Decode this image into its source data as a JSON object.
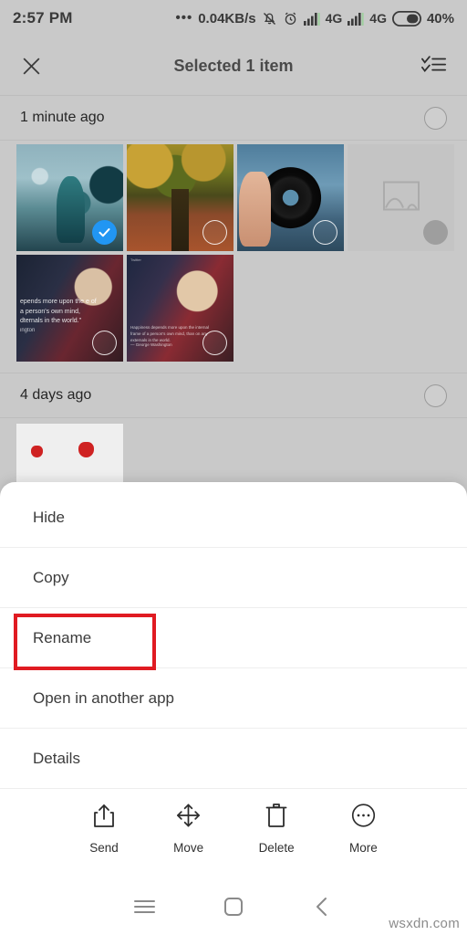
{
  "status_bar": {
    "time": "2:57 PM",
    "dots": "•••",
    "network_rate": "0.04KB/s",
    "alarm_icon": "alarm-icon",
    "silent_icon": "bell-muted-icon",
    "signal_1": "signal-bars-icon",
    "network_1": "4G",
    "signal_2": "signal-bars-icon",
    "network_2": "4G",
    "battery_icon": "battery-icon",
    "battery_level": "40%"
  },
  "app_bar": {
    "close_icon": "close-icon",
    "title": "Selected 1 item",
    "select_all_icon": "checklist-icon"
  },
  "sections": [
    {
      "title": "1 minute ago",
      "select_circle": "unchecked-circle",
      "rows": [
        [
          {
            "name": "statue-photo",
            "art": "art-statue",
            "badge": "checked"
          },
          {
            "name": "autumn-forest-photo",
            "art": "art-autumn",
            "badge": "unchecked"
          },
          {
            "name": "camera-lens-photo",
            "art": "art-lens",
            "badge": "unchecked"
          },
          {
            "name": "placeholder-photo",
            "art": "placeholder",
            "badge": "filled"
          }
        ],
        [
          {
            "name": "washington-quote-photo-1",
            "art": "art-wash1",
            "badge": "unchecked",
            "quote": "epends more upon the\ne of a person's own mind,\ndternals in the world.\"",
            "author": "ington"
          },
          {
            "name": "washington-quote-photo-2",
            "art": "art-wash2",
            "badge": "unchecked",
            "tag": "Twitter",
            "quote": "Happiness depends more upon the internal frame of\na person's own mind, than on any externals in the world.",
            "author": "— George Washington"
          }
        ]
      ]
    },
    {
      "title": "4 days ago",
      "select_circle": "unchecked-circle",
      "rows": []
    }
  ],
  "sheet": {
    "menu_items": [
      {
        "label": "Hide",
        "name": "menu-item-hide",
        "highlighted": false
      },
      {
        "label": "Copy",
        "name": "menu-item-copy",
        "highlighted": false
      },
      {
        "label": "Rename",
        "name": "menu-item-rename",
        "highlighted": true
      },
      {
        "label": "Open in another app",
        "name": "menu-item-open-in-another-app",
        "highlighted": false
      },
      {
        "label": "Details",
        "name": "menu-item-details",
        "highlighted": false
      }
    ],
    "highlight_color": "#e01b22",
    "actions": [
      {
        "label": "Send",
        "icon": "share-icon"
      },
      {
        "label": "Move",
        "icon": "move-arrows-icon"
      },
      {
        "label": "Delete",
        "icon": "trash-icon"
      },
      {
        "label": "More",
        "icon": "more-circle-icon"
      }
    ]
  },
  "nav_bar": {
    "menu_icon": "hamburger-menu-icon",
    "home_icon": "home-square-icon",
    "back_icon": "back-chevron-icon"
  },
  "watermark": "wsxdn.com",
  "colors": {
    "accent": "#2196f3",
    "highlight": "#e01b22",
    "background": "#c9c9c9",
    "sheet": "#ffffff"
  }
}
